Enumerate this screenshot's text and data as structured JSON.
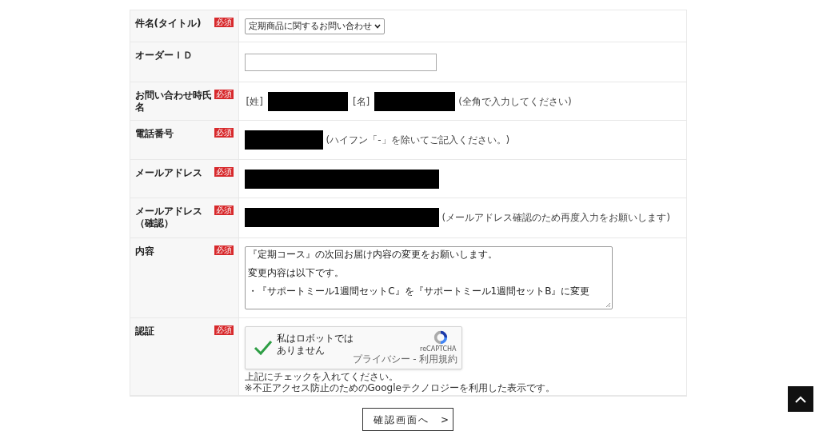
{
  "form_rows": [
    {
      "label": "件名(タイトル)",
      "required_badge": "必須",
      "controls": [
        {
          "kind": "select",
          "value": "定期商品に関するお問い合わせ"
        }
      ]
    },
    {
      "label": "オーダーＩＤ",
      "controls": [
        {
          "kind": "input"
        }
      ]
    },
    {
      "label": "お問い合わせ時氏名",
      "required_badge": "必須",
      "controls": [
        {
          "kind": "text",
          "text": "[姓]"
        },
        {
          "kind": "redacted"
        },
        {
          "kind": "text",
          "text": "[名]"
        },
        {
          "kind": "redacted"
        },
        {
          "kind": "note",
          "text": "(全角で入力してください)"
        }
      ]
    },
    {
      "label": "電話番号",
      "required_badge": "必須",
      "controls": [
        {
          "kind": "redacted"
        },
        {
          "kind": "note",
          "text": "(ハイフン「-」を除いてご記入ください。)"
        }
      ]
    },
    {
      "label": "メールアドレス",
      "required_badge": "必須",
      "controls": [
        {
          "kind": "redacted"
        }
      ]
    },
    {
      "label": "メールアドレス（確認）",
      "required_badge": "必須",
      "controls": [
        {
          "kind": "redacted"
        },
        {
          "kind": "note",
          "text": "(メールアドレス確認のため再度入力をお願いします)"
        }
      ]
    },
    {
      "label": "内容",
      "required_badge": "必須",
      "controls": [
        {
          "kind": "textarea",
          "lines": [
            "『定期コース』の次回お届け内容の変更をお願いします。",
            "変更内容は以下です。",
            "・『サポートミール1週間セットC』を『サポートミール1週間セットB』に変更"
          ]
        }
      ]
    },
    {
      "label": "認証",
      "required_badge": "必須",
      "controls": [
        {
          "kind": "captcha",
          "checked": true,
          "text": "私はロボットではありません",
          "brand": "reCAPTCHA",
          "links": "プライバシー - 利用規約"
        },
        {
          "kind": "hint",
          "text": "上記にチェックを入れてください。"
        },
        {
          "kind": "hint",
          "text": "※不正アクセス防止のためのGoogleテクノロジーを利用した表示です。"
        }
      ]
    }
  ],
  "submit_button": {
    "label": "確認画面へ",
    "arrow": ">"
  }
}
